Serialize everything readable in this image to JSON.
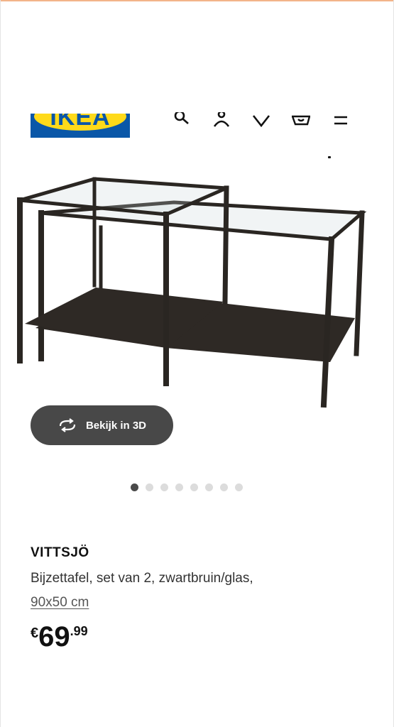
{
  "header": {
    "logo_text": "IKEA",
    "icons": [
      "search-icon",
      "user-icon",
      "heart-icon",
      "cart-icon",
      "menu-icon"
    ]
  },
  "viewer": {
    "button_3d_label": "Bekijk in 3D",
    "pager": {
      "total": 8,
      "active": 1
    }
  },
  "product": {
    "name": "VITTSJÖ",
    "description": "Bijzettafel, set van 2, zwartbruin/glas,",
    "size": "90x50 cm",
    "price": {
      "currency": "€",
      "integer": "69",
      "decimal": ".99"
    }
  },
  "colors": {
    "brand_blue": "#0a57a8",
    "brand_yellow": "#ffda1a",
    "button_bg": "#484848",
    "frame": "#2a2622"
  }
}
